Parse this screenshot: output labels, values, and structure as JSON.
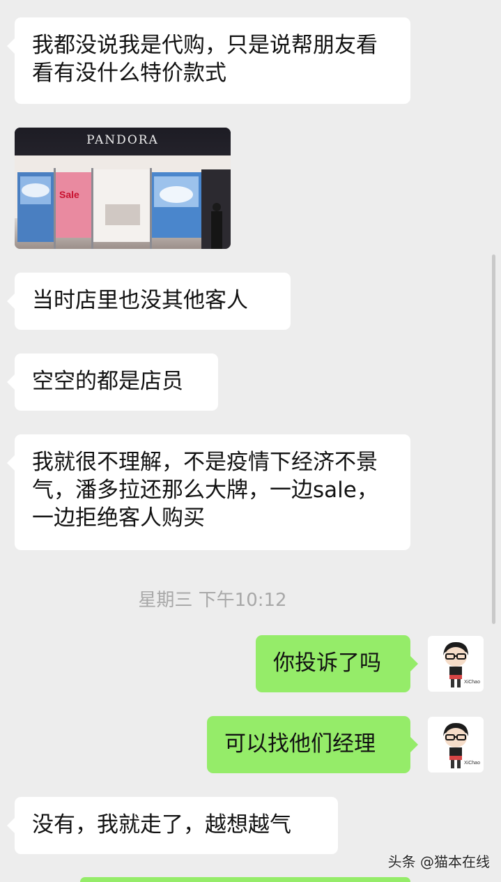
{
  "messages": [
    {
      "side": "in",
      "text": "我都没说我是代购，只是说帮朋友看看有没什么特价款式"
    },
    {
      "side": "in",
      "type": "image",
      "store_sign": "PANDORA",
      "sale_sign": "Sale"
    },
    {
      "side": "in",
      "text": "当时店里也没其他客人"
    },
    {
      "side": "in",
      "text": "空空的都是店员"
    },
    {
      "side": "in",
      "text": "我就很不理解，不是疫情下经济不景气，潘多拉还那么大牌，一边sale，一边拒绝客人购买"
    },
    {
      "side": "out",
      "text": "你投诉了吗"
    },
    {
      "side": "out",
      "text": "可以找他们经理"
    },
    {
      "side": "in",
      "text": "没有，我就走了，越想越气"
    }
  ],
  "timestamp": "星期三 下午10:12",
  "avatar_caption": "XiChao",
  "watermark": "头条 @猫本在线",
  "colors": {
    "background": "#ededed",
    "incoming_bubble": "#ffffff",
    "outgoing_bubble": "#95ec69",
    "timestamp": "#a8a8a8"
  }
}
